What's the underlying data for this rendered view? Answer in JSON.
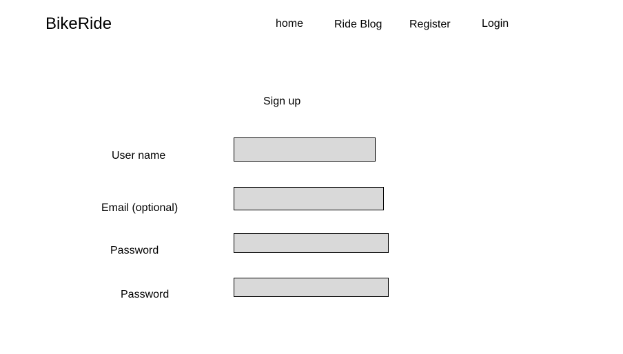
{
  "brand": {
    "name": "BikeRide"
  },
  "nav": {
    "items": [
      {
        "label": "home"
      },
      {
        "label": "Ride Blog"
      },
      {
        "label": "Register"
      },
      {
        "label": "Login"
      }
    ]
  },
  "form": {
    "title": "Sign up",
    "fields": [
      {
        "label": "User name",
        "value": "",
        "placeholder": ""
      },
      {
        "label": "Email (optional)",
        "value": "",
        "placeholder": ""
      },
      {
        "label": "Password",
        "value": "",
        "placeholder": ""
      },
      {
        "label": "Password",
        "value": "",
        "placeholder": ""
      }
    ]
  },
  "colors": {
    "background": "#ffffff",
    "input_fill": "#d9d9d9",
    "input_border": "#000000",
    "text": "#000000"
  }
}
